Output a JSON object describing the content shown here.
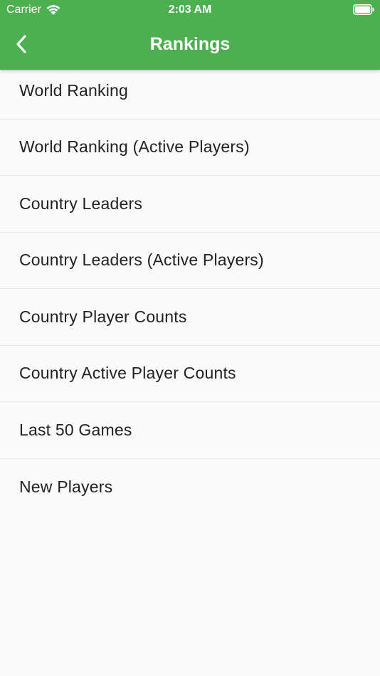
{
  "status_bar": {
    "carrier": "Carrier",
    "time": "2:03 AM"
  },
  "nav": {
    "title": "Rankings",
    "back_icon": "chevron-left-icon"
  },
  "colors": {
    "header_bg": "#4caf50",
    "header_text": "#ffffff",
    "list_text": "#222222",
    "divider": "#e6e6e6",
    "background": "#fafafa"
  },
  "rankings": {
    "items": [
      {
        "label": "World Ranking"
      },
      {
        "label": "World Ranking (Active Players)"
      },
      {
        "label": "Country Leaders"
      },
      {
        "label": "Country Leaders (Active Players)"
      },
      {
        "label": "Country Player Counts"
      },
      {
        "label": "Country Active Player Counts"
      },
      {
        "label": "Last 50 Games"
      },
      {
        "label": "New Players"
      }
    ]
  }
}
